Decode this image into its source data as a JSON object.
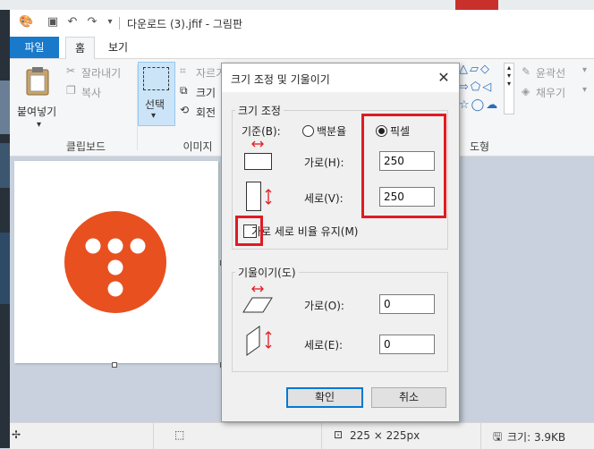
{
  "title": "다운로드 (3).jfif - 그림판",
  "tabs": {
    "file": "파일",
    "home": "홈",
    "view": "보기"
  },
  "clipboard": {
    "paste": "붙여넣기",
    "cut": "잘라내기",
    "copy": "복사",
    "label": "클립보드"
  },
  "image": {
    "select": "선택",
    "crop": "자르기",
    "resize": "크기",
    "rotate": "회전",
    "label": "이미지"
  },
  "shapes": {
    "outline": "윤곽선",
    "fill": "채우기",
    "label": "도형"
  },
  "status": {
    "size_px": "225 × 225px",
    "file_size": "크기: 3.9KB"
  },
  "dialog": {
    "title": "크기 조정 및 기울이기",
    "resize_group": "크기 조정",
    "basis_label": "기준(B):",
    "percent": "백분율",
    "pixel": "픽셀",
    "horizontal": "가로(H):",
    "vertical": "세로(V):",
    "h_value": "250",
    "v_value": "250",
    "keep_ratio": "가로 세로 비율 유지(M)",
    "skew_group": "기울이기(도)",
    "skew_h": "가로(O):",
    "skew_v": "세로(E):",
    "skew_h_value": "0",
    "skew_v_value": "0",
    "ok": "확인",
    "cancel": "취소"
  },
  "colors": {
    "accent": "#1979ca",
    "logo": "#e8501f",
    "highlight": "#e01b22"
  }
}
